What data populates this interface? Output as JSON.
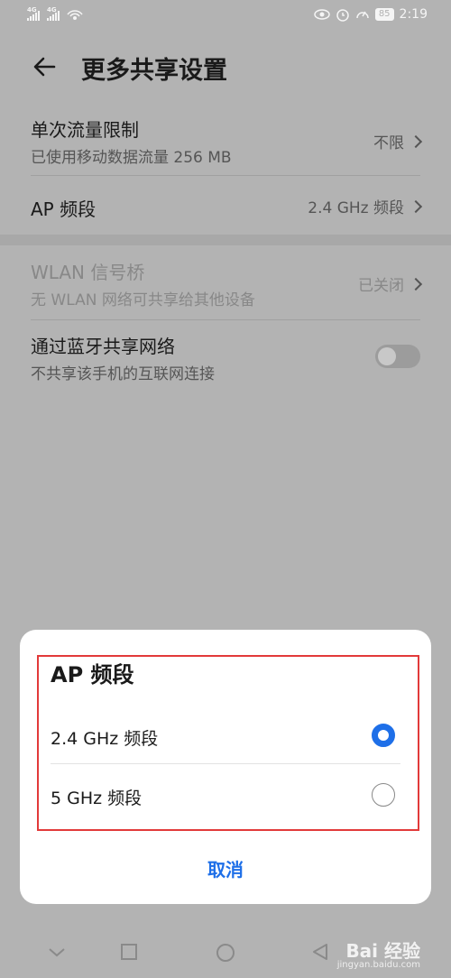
{
  "status_bar": {
    "signal1_label": "4G",
    "signal2_label": "4G",
    "battery": "85",
    "time": "2:19"
  },
  "header": {
    "title": "更多共享设置"
  },
  "settings": {
    "data_limit": {
      "title": "单次流量限制",
      "subtitle": "已使用移动数据流量 256 MB",
      "value": "不限"
    },
    "ap_band": {
      "title": "AP 频段",
      "value": "2.4 GHz 频段"
    },
    "wlan_bridge": {
      "title": "WLAN 信号桥",
      "subtitle": "无 WLAN 网络可共享给其他设备",
      "value": "已关闭"
    },
    "bluetooth_share": {
      "title": "通过蓝牙共享网络",
      "subtitle": "不共享该手机的互联网连接",
      "enabled": false
    }
  },
  "dialog": {
    "title": "AP 频段",
    "options": [
      {
        "label": "2.4 GHz 频段",
        "selected": true
      },
      {
        "label": "5 GHz 频段",
        "selected": false
      }
    ],
    "cancel_label": "取消"
  },
  "watermark": {
    "brand": "Bai 经验",
    "url": "jingyan.baidu.com"
  },
  "colors": {
    "accent": "#1e6fe8",
    "highlight_border": "#e23a3a",
    "overlay_bg": "#b3b3b3"
  }
}
